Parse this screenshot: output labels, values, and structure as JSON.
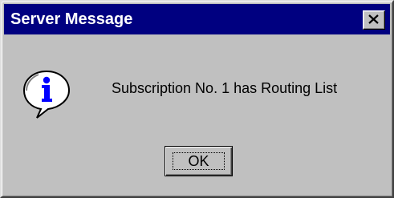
{
  "window": {
    "title": "Server Message",
    "close_icon": "close-x-icon"
  },
  "content": {
    "icon": "info-icon",
    "message": "Subscription No. 1 has Routing List"
  },
  "buttons": {
    "ok_label": "OK"
  },
  "colors": {
    "titlebar": "#000080",
    "face": "#c0c0c0",
    "info_blue": "#0000ff"
  }
}
